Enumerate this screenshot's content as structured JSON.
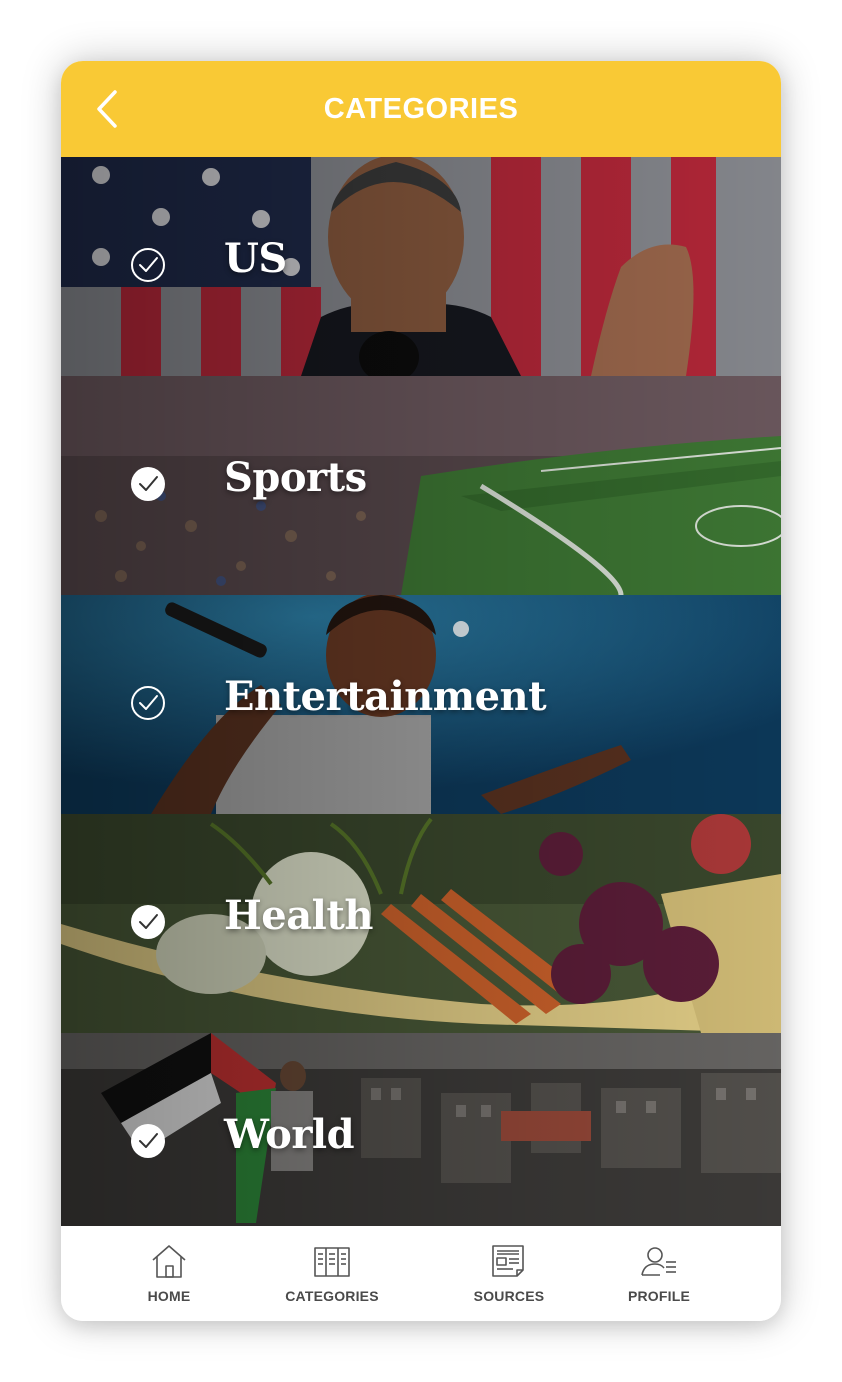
{
  "header": {
    "title": "CATEGORIES",
    "back_icon": "chevron-left-icon"
  },
  "colors": {
    "accent": "#f9c935",
    "tab_text": "#4a4a4a",
    "icon_stroke": "#555555"
  },
  "categories": [
    {
      "label": "US",
      "selected": true
    },
    {
      "label": "Sports",
      "selected": true
    },
    {
      "label": "Entertainment",
      "selected": true
    },
    {
      "label": "Health",
      "selected": true
    },
    {
      "label": "World",
      "selected": true
    }
  ],
  "tabbar": {
    "items": [
      {
        "label": "HOME",
        "icon": "home-icon"
      },
      {
        "label": "CATEGORIES",
        "icon": "categories-icon"
      },
      {
        "label": "SOURCES",
        "icon": "newspaper-icon"
      },
      {
        "label": "PROFILE",
        "icon": "profile-icon"
      }
    ]
  }
}
